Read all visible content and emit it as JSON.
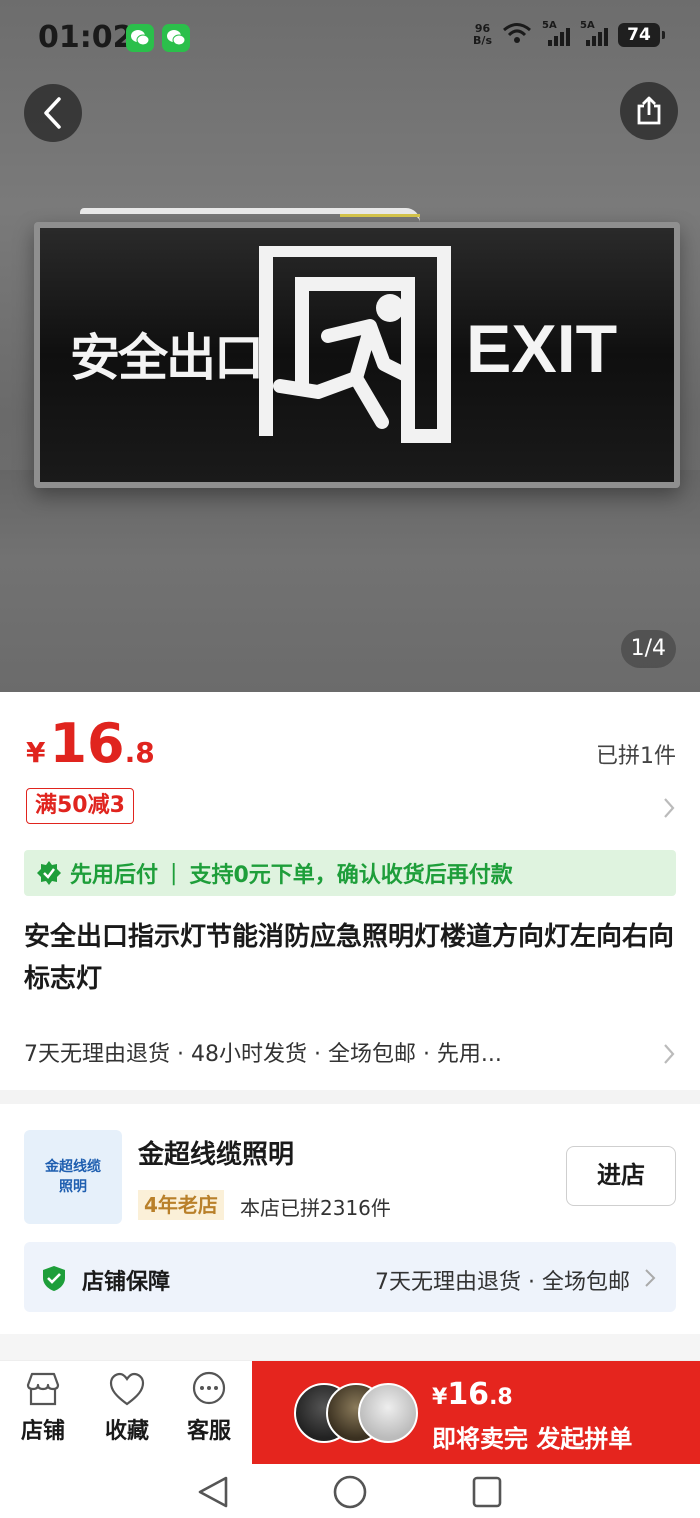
{
  "status_bar": {
    "time": "01:02",
    "net_speed_top": "96",
    "net_speed_bottom": "B/s",
    "signal1_label": "5A",
    "signal2_label": "5A",
    "battery": "74"
  },
  "hero": {
    "sign_text_cn": "安全出口",
    "sign_text_en": "EXIT",
    "pager": "1/4"
  },
  "price": {
    "symbol": "¥",
    "integer": "16",
    "decimal": ".8",
    "sold": "已拼1件"
  },
  "coupon": "满50减3",
  "pay_later": {
    "label": "先用后付",
    "separator": "|",
    "detail": "支持0元下单，确认收货后再付款"
  },
  "product_title": "安全出口指示灯节能消防应急照明灯楼道方向灯左向右向标志灯",
  "services": "7天无理由退货 · 48小时发货 · 全场包邮 · 先用...",
  "shop": {
    "logo_line1": "金超线缆",
    "logo_line2": "照明",
    "name": "金超线缆照明",
    "age_badge": "4年老店",
    "sold": "本店已拼2316件",
    "enter_label": "进店",
    "guarantee_label": "店铺保障",
    "guarantee_detail": "7天无理由退货 · 全场包邮"
  },
  "bottom_bar": {
    "tabs": [
      {
        "label": "店铺",
        "icon": "store-icon"
      },
      {
        "label": "收藏",
        "icon": "heart-icon"
      },
      {
        "label": "客服",
        "icon": "chat-icon"
      }
    ],
    "buy_symbol": "¥",
    "buy_price_int": "16",
    "buy_price_dec": ".8",
    "buy_label": "即将卖完 发起拼单"
  },
  "colors": {
    "price_red": "#e0241e",
    "buy_button": "#e5251e",
    "pay_later_green": "#1e9e3a",
    "guarantee_bg": "#eef3fb"
  }
}
